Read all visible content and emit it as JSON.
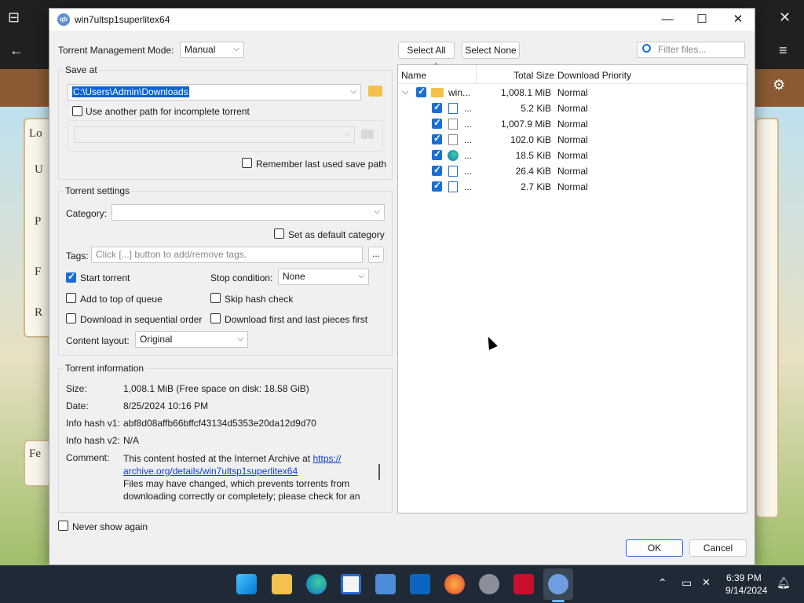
{
  "dialog": {
    "title": "win7ultsp1superlitex64",
    "window_buttons": {
      "minimize": "—",
      "maximize": "☐",
      "close": "✕"
    }
  },
  "left": {
    "management_mode_label": "Torrent Management Mode:",
    "management_mode_value": "Manual",
    "save_at": {
      "title": "Save at",
      "path": "C:\\Users\\Admin\\Downloads",
      "incomplete_path_label": "Use another path for incomplete torrent",
      "incomplete_path_checked": false,
      "remember_label": "Remember last used save path",
      "remember_checked": false
    },
    "settings": {
      "title": "Torrent settings",
      "category_label": "Category:",
      "category_value": "",
      "default_category_label": "Set as default category",
      "tags_label": "Tags:",
      "tags_placeholder": "Click [...] button to add/remove tags.",
      "tags_button": "...",
      "start_torrent_label": "Start torrent",
      "start_torrent_checked": true,
      "stop_condition_label": "Stop condition:",
      "stop_condition_value": "None",
      "add_top_label": "Add to top of queue",
      "skip_hash_label": "Skip hash check",
      "sequential_label": "Download in sequential order",
      "first_last_label": "Download first and last pieces first",
      "content_layout_label": "Content layout:",
      "content_layout_value": "Original"
    },
    "info": {
      "title": "Torrent information",
      "size_label": "Size:",
      "size_value": "1,008.1 MiB (Free space on disk: 18.58 GiB)",
      "date_label": "Date:",
      "date_value": "8/25/2024 10:16 PM",
      "hash1_label": "Info hash v1:",
      "hash1_value": "abf8d08affb66bffcf43134d5353e20da12d9d70",
      "hash2_label": "Info hash v2:",
      "hash2_value": "N/A",
      "comment_label": "Comment:",
      "comment_line1": "This content hosted at the Internet Archive at",
      "comment_link1": "https://",
      "comment_link2": "archive.org/details/win7ultsp1superlitex64",
      "comment_line3": "Files may have changed, which prevents torrents from",
      "comment_line4": "downloading correctly or completely; please check for an"
    },
    "never_show_label": "Never show again"
  },
  "right": {
    "select_all": "Select All",
    "select_none": "Select None",
    "filter_placeholder": "Filter files...",
    "columns": {
      "name": "Name",
      "size": "Total Size",
      "priority": "Download Priority"
    },
    "rows": [
      {
        "name": "win...",
        "size": "1,008.1 MiB",
        "priority": "Normal",
        "icon": "folder-icon"
      },
      {
        "name": "...",
        "size": "5.2 KiB",
        "priority": "Normal",
        "icon": "document-icon"
      },
      {
        "name": "...",
        "size": "1,007.9 MiB",
        "priority": "Normal",
        "icon": "file-icon"
      },
      {
        "name": "...",
        "size": "102.0 KiB",
        "priority": "Normal",
        "icon": "file-icon"
      },
      {
        "name": "...",
        "size": "18.5 KiB",
        "priority": "Normal",
        "icon": "edge-icon"
      },
      {
        "name": "...",
        "size": "26.4 KiB",
        "priority": "Normal",
        "icon": "document-icon"
      },
      {
        "name": "...",
        "size": "2.7 KiB",
        "priority": "Normal",
        "icon": "document-icon"
      }
    ]
  },
  "buttons": {
    "ok": "OK",
    "cancel": "Cancel"
  },
  "background": {
    "labels": [
      "Lo",
      "U",
      "P",
      "F",
      "R",
      "Fe"
    ]
  },
  "taskbar": {
    "time": "6:39 PM",
    "date": "9/14/2024"
  }
}
